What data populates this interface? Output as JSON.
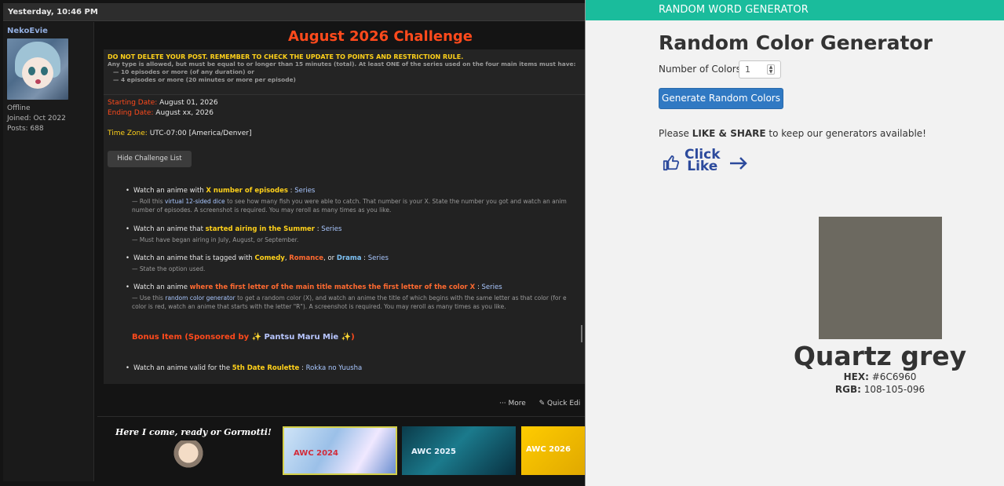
{
  "forum": {
    "timestamp": "Yesterday, 10:46 PM",
    "user": {
      "name": "NekoEvie",
      "status": "Offline",
      "joined": "Joined: Oct 2022",
      "posts": "Posts: 688"
    },
    "post": {
      "title": "August 2026 Challenge",
      "warning": "DO NOT DELETE YOUR POST. REMEMBER TO CHECK THE UPDATE TO POINTS AND RESTRICTION RULE.",
      "rule_line1": "Any type is allowed, but must be equal to or longer than 15 minutes (total). At least ONE of the series used on the four main items must have:",
      "rule_line2": "— 10 episodes or more (of any duration) or",
      "rule_line3": "— 4 episodes or more (20 minutes or more per episode)",
      "starting_label": "Starting Date:",
      "starting_value": " August 01, 2026",
      "ending_label": "Ending Date:",
      "ending_value": " August xx, 2026",
      "timezone_label": "Time Zone:",
      "timezone_value": " UTC-07:00 [America/Denver]",
      "hide_button": "Hide Challenge List",
      "items": [
        {
          "prefix": "Watch an anime with ",
          "hl": "X number of episodes",
          "suffix": " : ",
          "series": "Series",
          "sub1a": "— Roll this ",
          "sub1link": "virtual 12-sided dice",
          "sub1b": " to see how many fish you were able to catch. That number is your X. State the number you got and watch an anim",
          "sub2": "number of episodes. A screenshot is required. You may reroll as many times as you like."
        },
        {
          "prefix": "Watch an anime that ",
          "hl": "started airing in the Summer",
          "suffix": " : ",
          "series": "Series",
          "sub1": "— Must have began airing in July, August, or September."
        },
        {
          "prefix": "Watch an anime that is tagged with ",
          "hl1": "Comedy",
          "sep1": ", ",
          "hl2": "Romance",
          "sep2": ", or ",
          "hl3": "Drama",
          "suffix": " : ",
          "series": "Series",
          "sub1": "— State the option used."
        },
        {
          "prefix": "Watch an anime ",
          "hl": "where the first letter of the main title matches the first letter of the color X",
          "suffix": " : ",
          "series": "Series",
          "sub1a": "— Use this ",
          "sub1link": "random color generator",
          "sub1b": " to get a random color (X), and watch an anime the title of which begins with the same letter as that color (for e",
          "sub2": "color is red, watch an anime that starts with the letter \"R\"). A screenshot is required. You may reroll as many times as you like."
        }
      ],
      "bonus_prefix": "Bonus Item (Sponsored by ✨ ",
      "bonus_sponsor": "Pantsu Maru Mie",
      "bonus_suffix": " ✨)",
      "bonus_item": {
        "prefix": "Watch an anime valid for the ",
        "hl": "5th Date Roulette",
        "suffix": " : ",
        "series": "Rokka no Yuusha"
      }
    },
    "actions": {
      "more": "··· More",
      "quick_edit": "✎ Quick Edi"
    },
    "signature": {
      "text": "Here I come, ready or Gormotti!",
      "banners": [
        "AWC 2024",
        "AWC 2025",
        "AWC 2026"
      ]
    }
  },
  "generator": {
    "top_bar": "RANDOM WORD GENERATOR",
    "title": "Random Color Generator",
    "num_label": "Number of Colors:",
    "num_value": "1",
    "generate_button": "Generate Random Colors",
    "share_prefix": "Please ",
    "share_bold": "LIKE & SHARE",
    "share_suffix": " to keep our generators available!",
    "like_line1": "Click",
    "like_line2": "Like",
    "result": {
      "name": "Quartz grey",
      "hex_label": "HEX:",
      "hex_value": " #6C6960",
      "rgb_label": "RGB:",
      "rgb_value": " 108-105-096",
      "swatch_color": "#6C6960"
    },
    "colors": {
      "bar": "#1abc9c",
      "button": "#3079c3",
      "like": "#2c4a9c"
    }
  }
}
